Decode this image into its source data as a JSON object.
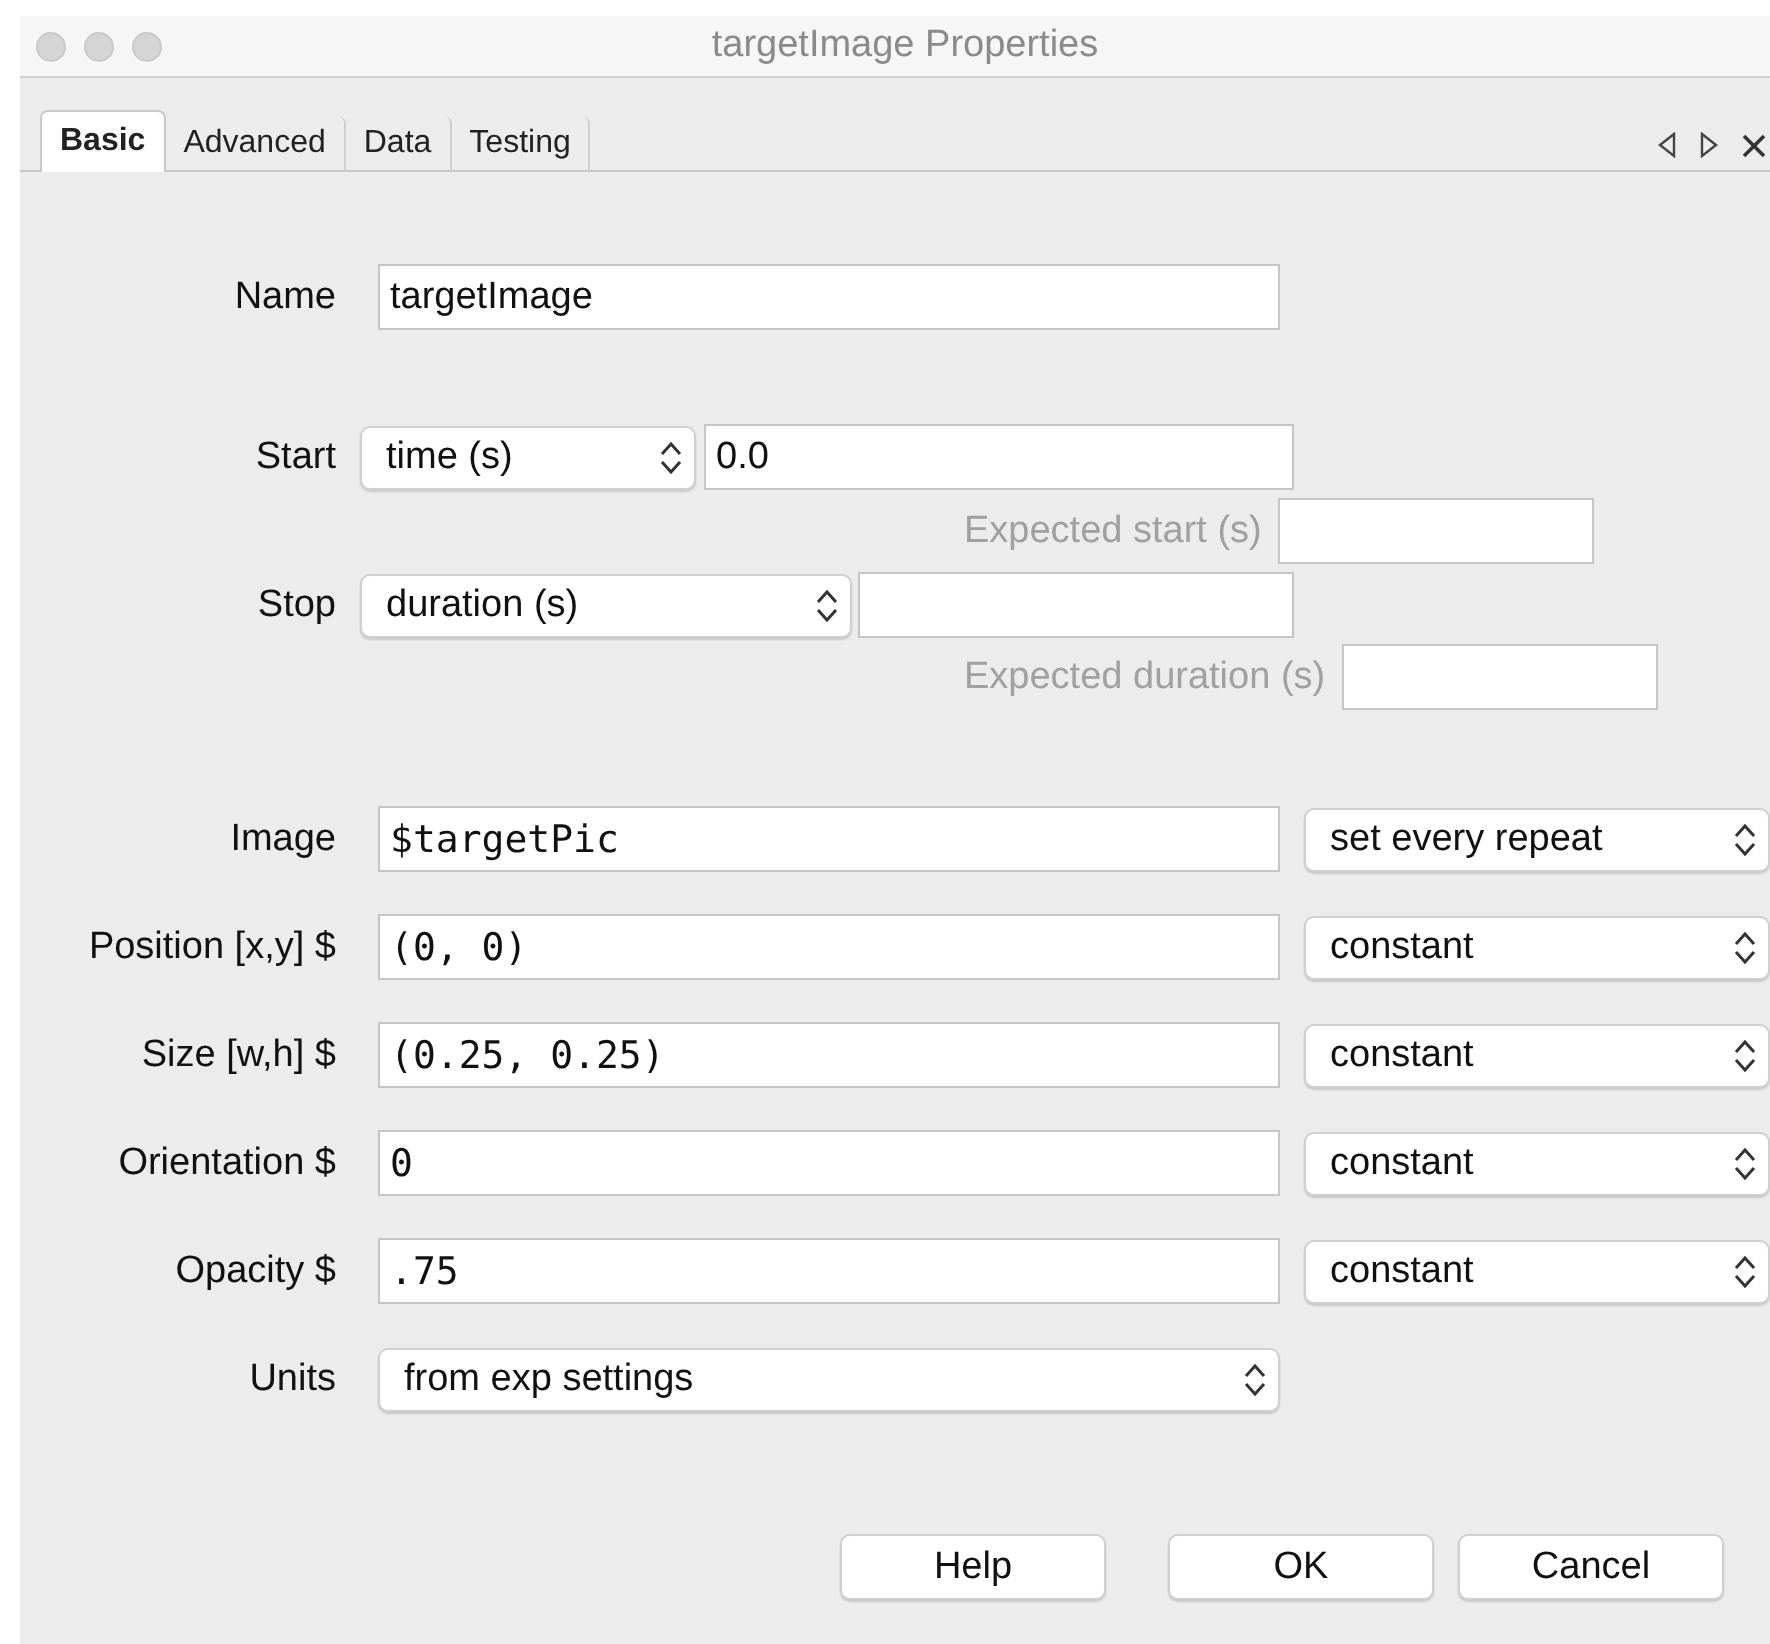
{
  "window": {
    "title": "targetImage Properties"
  },
  "tabs": [
    {
      "label": "Basic",
      "selected": true
    },
    {
      "label": "Advanced",
      "selected": false
    },
    {
      "label": "Data",
      "selected": false
    },
    {
      "label": "Testing",
      "selected": false
    }
  ],
  "name": {
    "label": "Name",
    "value": "targetImage"
  },
  "start": {
    "label": "Start",
    "type": "time (s)",
    "value": "0.0",
    "expected_label": "Expected start (s)"
  },
  "stop": {
    "label": "Stop",
    "type": "duration (s)",
    "expected_label": "Expected duration (s)"
  },
  "params": [
    {
      "label": "Image",
      "value": "$targetPic",
      "update": "set every repeat"
    },
    {
      "label": "Position [x,y] $",
      "value": "(0, 0)",
      "update": "constant"
    },
    {
      "label": "Size [w,h] $",
      "value": "(0.25, 0.25)",
      "update": "constant"
    },
    {
      "label": "Orientation $",
      "value": "0",
      "update": "constant"
    },
    {
      "label": "Opacity $",
      "value": ".75",
      "update": "constant"
    }
  ],
  "units": {
    "label": "Units",
    "value": "from exp settings"
  },
  "buttons": [
    "Help",
    "OK",
    "Cancel"
  ]
}
